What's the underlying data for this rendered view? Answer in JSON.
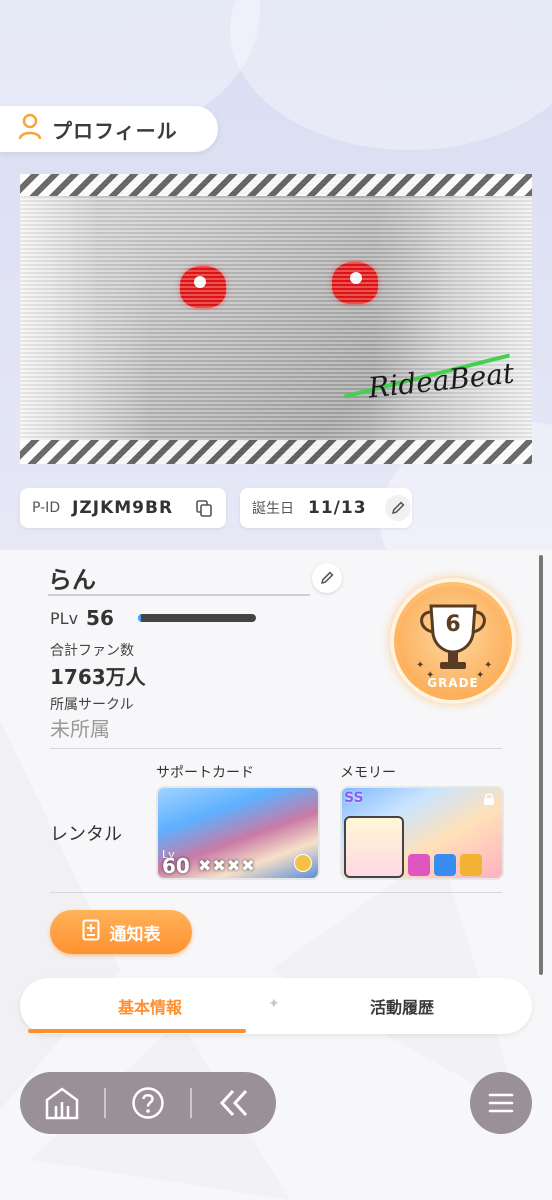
{
  "header": {
    "title": "プロフィール"
  },
  "banner": {
    "logo_text": "RideaBeat"
  },
  "ids": {
    "pid_key": "P-ID",
    "pid_value": "JZJKM9BR",
    "birthday_key": "誕生日",
    "birthday_value": "11/13"
  },
  "profile": {
    "name": "らん",
    "plv_key": "PLv",
    "plv_value": "56",
    "plv_progress": 0.03,
    "fans_key": "合計ファン数",
    "fans_value": "1763万人",
    "circle_key": "所属サークル",
    "circle_value": "未所属"
  },
  "grade": {
    "number": "6",
    "label": "GRADE"
  },
  "rental": {
    "label": "レンタル",
    "support_label": "サポートカード",
    "memory_label": "メモリー",
    "support_lv_prefix": "Lv",
    "support_lv": "60",
    "support_marks": "✖✖✖✖",
    "memory_rank": "SS"
  },
  "actions": {
    "notice_label": "通知表"
  },
  "tabs": [
    {
      "label": "基本情報",
      "active": true
    },
    {
      "label": "活動履歴",
      "active": false
    }
  ],
  "colors": {
    "accent": "#ff8f2e",
    "nav_bg": "#9a9097",
    "grade_gold": "#ffb866"
  }
}
